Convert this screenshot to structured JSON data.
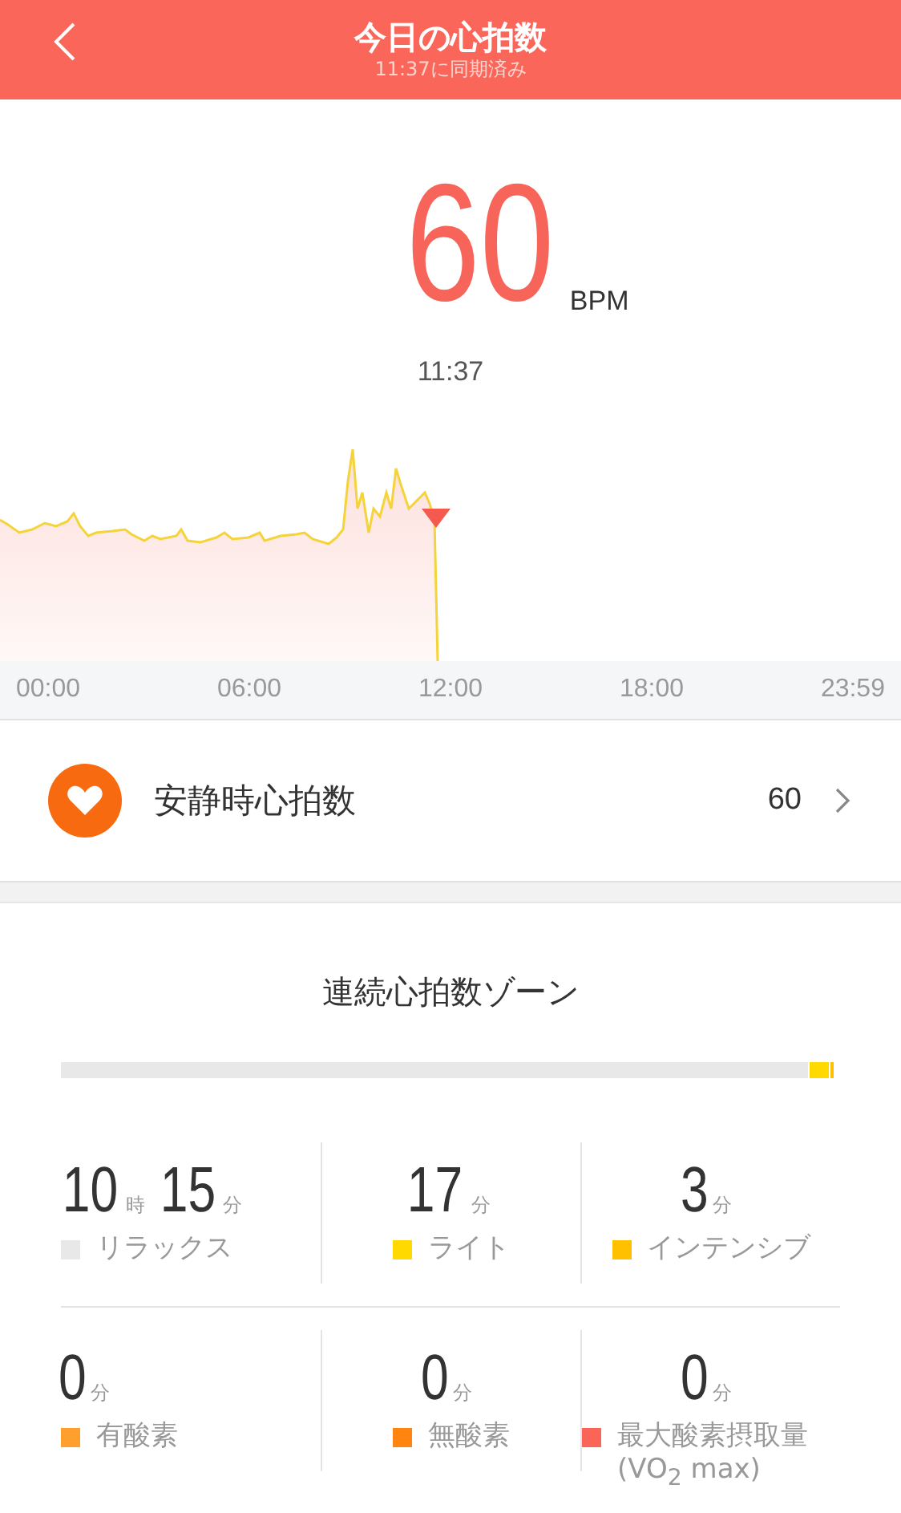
{
  "header": {
    "title": "今日の心拍数",
    "subtitle": "11:37に同期済み"
  },
  "current": {
    "value": "60",
    "unit": "BPM",
    "time": "11:37"
  },
  "chart": {
    "x_labels": [
      "00:00",
      "06:00",
      "12:00",
      "18:00",
      "23:59"
    ]
  },
  "resting": {
    "label": "安静時心拍数",
    "value": "60"
  },
  "zones": {
    "title": "連続心拍数ゾーン",
    "items": [
      {
        "parts": [
          {
            "number": "10",
            "unit": "時"
          },
          {
            "number": "15",
            "unit": "分"
          }
        ],
        "label": "リラックス",
        "color": "#e8e8e8"
      },
      {
        "parts": [
          {
            "number": "17",
            "unit": "分"
          }
        ],
        "label": "ライト",
        "color": "#ffd900"
      },
      {
        "parts": [
          {
            "number": "3",
            "unit": "分"
          }
        ],
        "label": "インテンシブ",
        "color": "#ffc000"
      },
      {
        "parts": [
          {
            "number": "0",
            "unit": "分"
          }
        ],
        "label": "有酸素",
        "color": "#ff9f2e"
      },
      {
        "parts": [
          {
            "number": "0",
            "unit": "分"
          }
        ],
        "label": "無酸素",
        "color": "#ff8410"
      },
      {
        "parts": [
          {
            "number": "0",
            "unit": "分"
          }
        ],
        "label": "最大酸素摂取量 (VO$_{2}$ max)",
        "color": "#fa6558"
      }
    ]
  }
}
